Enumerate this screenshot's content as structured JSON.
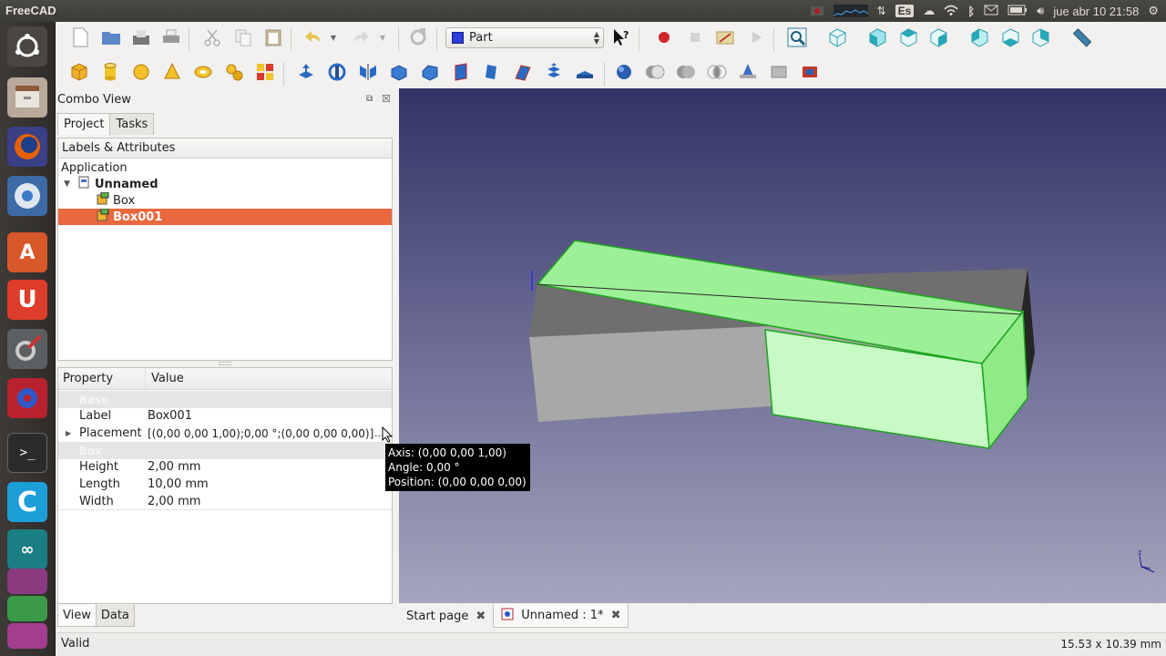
{
  "app": {
    "title": "FreeCAD"
  },
  "tray": {
    "lang": "Es",
    "clock": "jue abr 10  21:58"
  },
  "launcher": {
    "icons": [
      "ubuntu-dash-icon",
      "files-icon",
      "firefox-icon",
      "chromium-icon",
      "software-center-icon",
      "ubuntu-one-icon",
      "system-settings-icon",
      "freecad-icon",
      "terminal-icon",
      "app-c-icon",
      "arduino-icon",
      "app-stack-icon",
      "app-stack-2-icon",
      "app-stack-3-icon"
    ]
  },
  "toolbar": {
    "workbench": "Part"
  },
  "combo": {
    "title": "Combo View",
    "tabs": [
      "Project",
      "Tasks"
    ],
    "tree_header": "Labels & Attributes",
    "tree": {
      "root": "Application",
      "doc": "Unnamed",
      "items": [
        "Box",
        "Box001"
      ]
    },
    "props_header": {
      "property": "Property",
      "value": "Value"
    },
    "groups": {
      "base": "Base",
      "box": "Box"
    },
    "props": {
      "label": {
        "name": "Label",
        "value": "Box001"
      },
      "placement": {
        "name": "Placement",
        "value": "[(0,00 0,00 1,00);0,00 °;(0,00 0,00 0,00)]",
        "more": "..."
      },
      "height": {
        "name": "Height",
        "value": "2,00 mm"
      },
      "length": {
        "name": "Length",
        "value": "10,00 mm"
      },
      "width": {
        "name": "Width",
        "value": "2,00 mm"
      }
    },
    "bottom_tabs": [
      "View",
      "Data"
    ]
  },
  "tooltip": {
    "line1": "Axis: (0,00 0,00 1,00)",
    "line2": "Angle: 0,00 °",
    "line3": "Position: (0,00 0,00 0,00)"
  },
  "doc_tabs": {
    "start": "Start page",
    "doc": "Unnamed : 1*"
  },
  "status": {
    "message": "Valid",
    "dims": "15.53 x 10.39 mm"
  },
  "colors": {
    "selection": "#e9683e",
    "highlight_green": "#8ff58a",
    "box_gray": "#a9a9a9"
  }
}
